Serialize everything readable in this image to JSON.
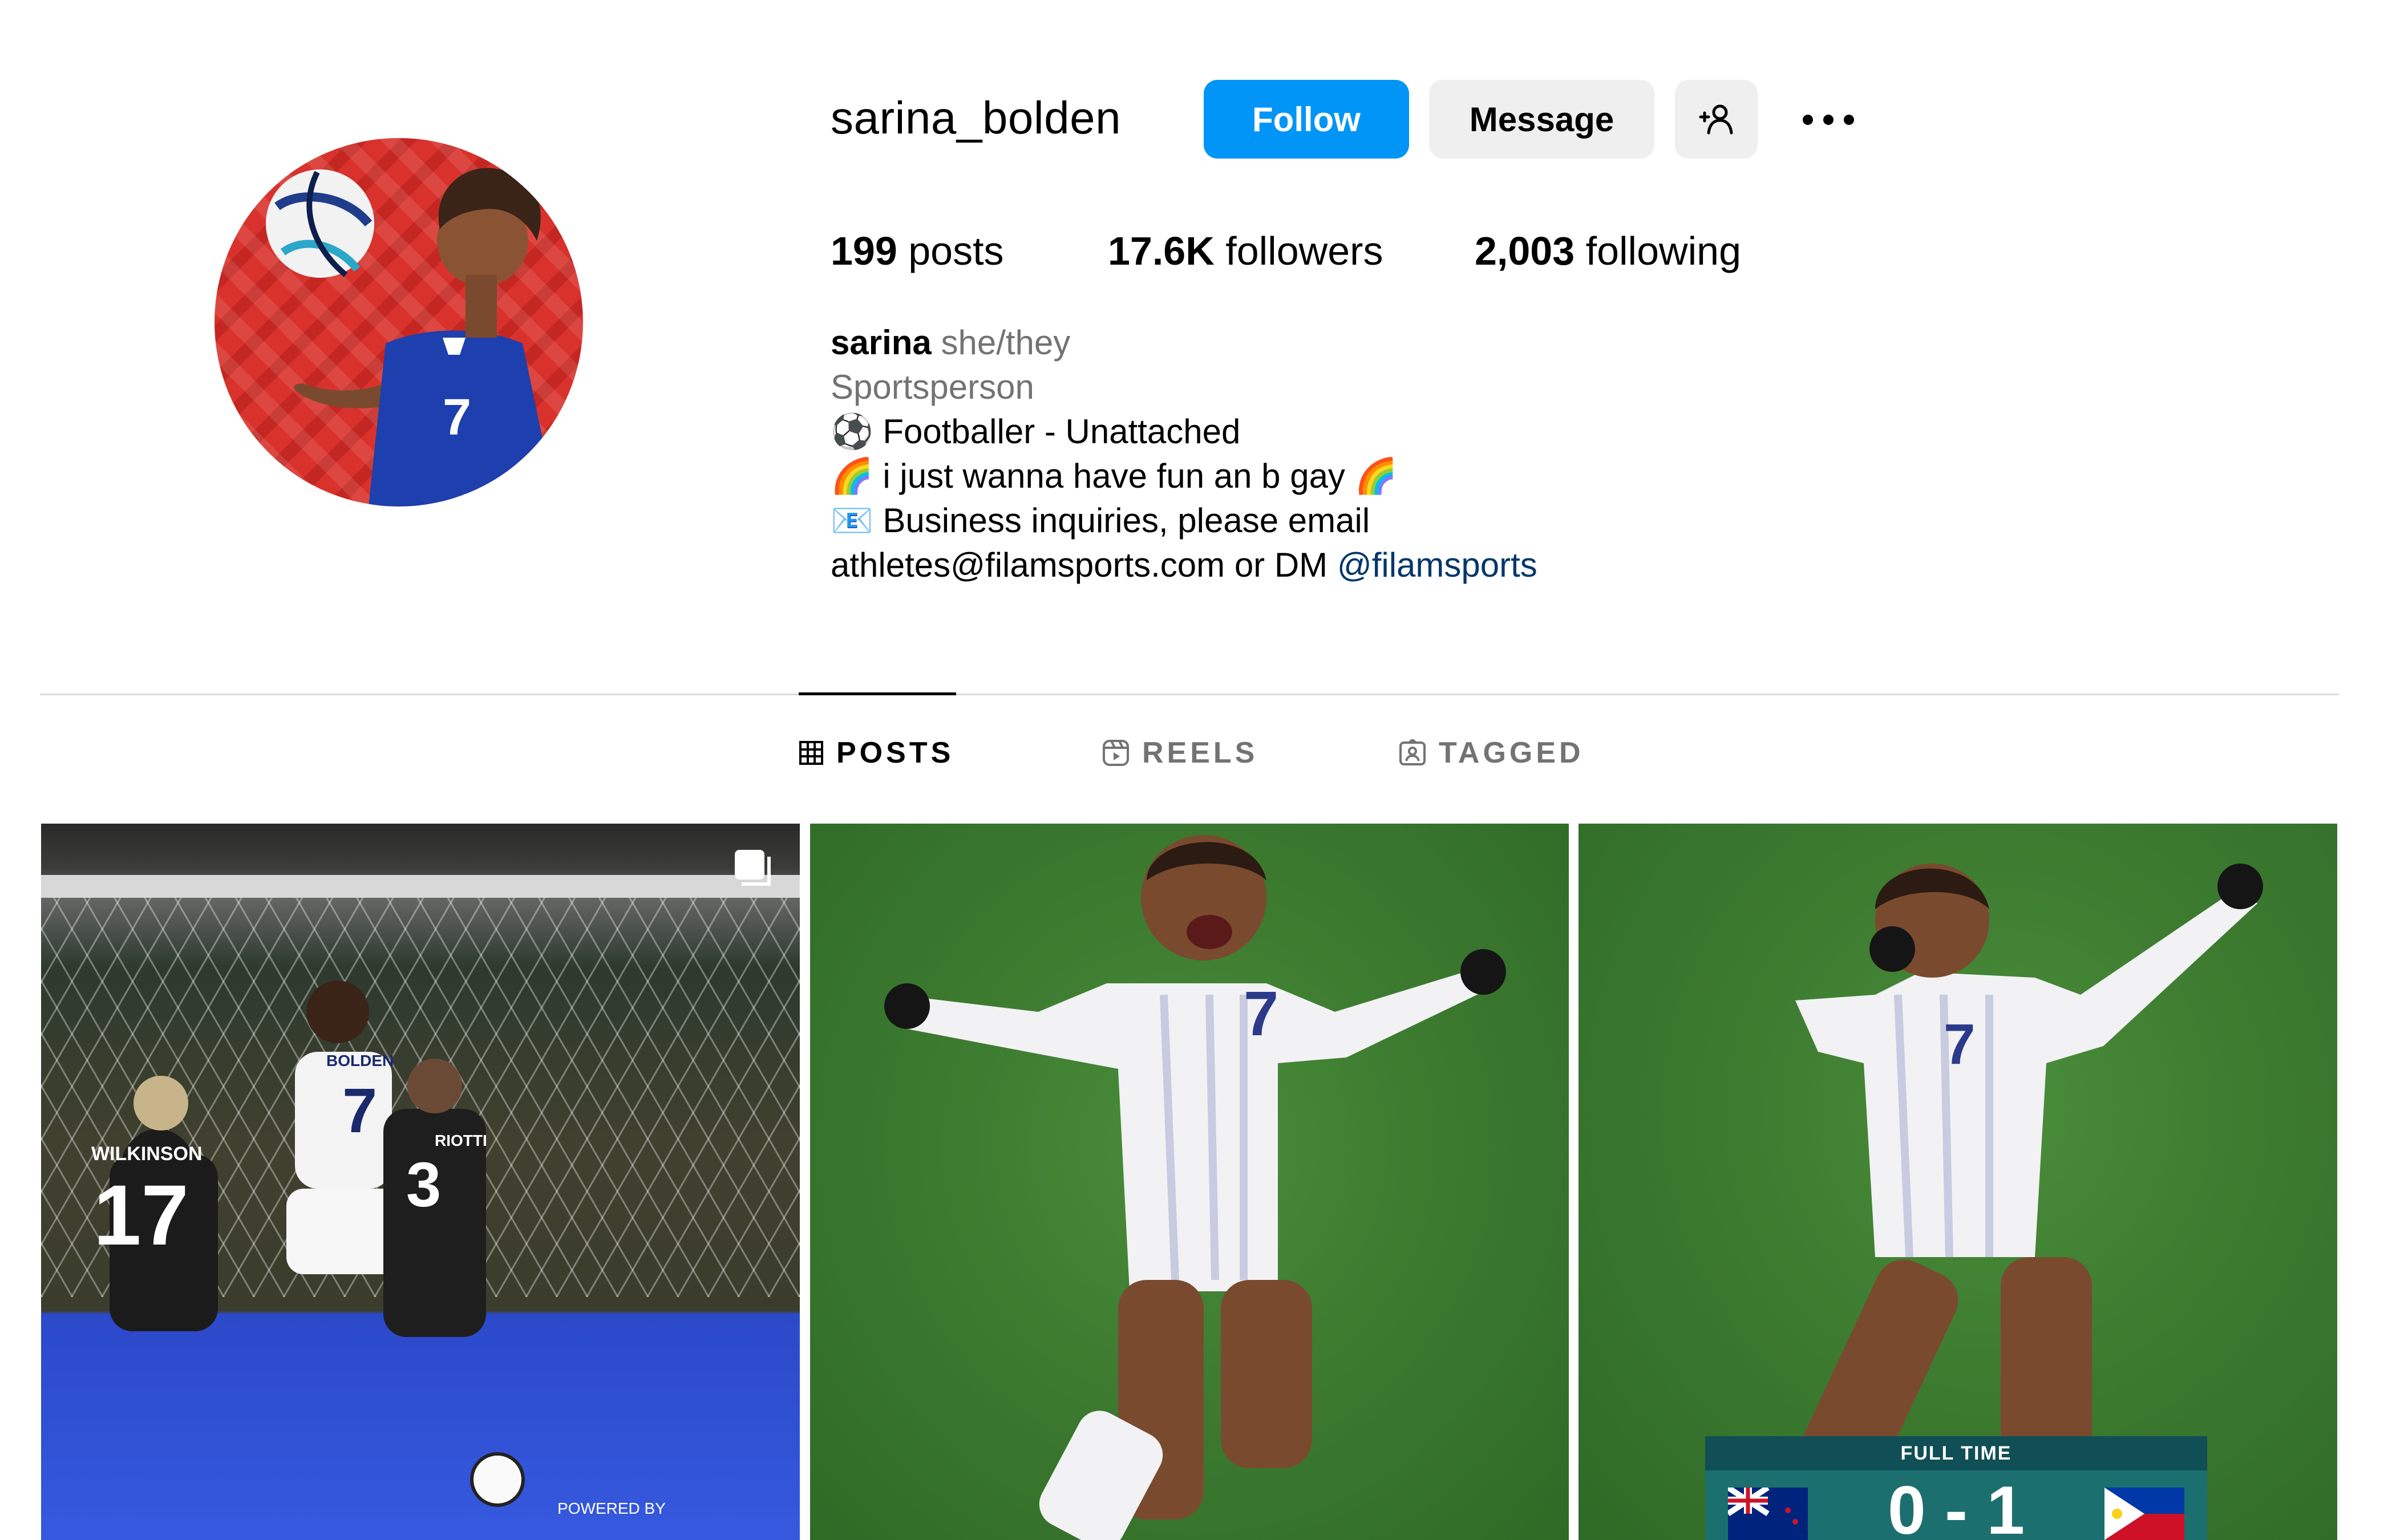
{
  "profile": {
    "username": "sarina_bolden",
    "follow_label": "Follow",
    "message_label": "Message"
  },
  "stats": {
    "posts_count": "199",
    "posts_label": "posts",
    "followers_count": "17.6K",
    "followers_label": "followers",
    "following_count": "2,003",
    "following_label": "following"
  },
  "bio": {
    "name": "sarina",
    "pronouns": "she/they",
    "category": "Sportsperson",
    "line1": "⚽ Footballer - Unattached",
    "line2": "🌈 i just wanna have fun an b gay 🌈",
    "line3": "📧 Business inquiries, please email",
    "line4_text": "athletes@filamsports.com or DM ",
    "line4_link": "@filamsports"
  },
  "tabs": [
    {
      "label": "POSTS",
      "icon": "grid-icon",
      "active": true
    },
    {
      "label": "REELS",
      "icon": "reels-icon",
      "active": false
    },
    {
      "label": "TAGGED",
      "icon": "tagged-icon",
      "active": false
    }
  ],
  "posts": {
    "post1": {
      "jersey_left": "17",
      "name_left": "WILKINSON",
      "jersey_center": "7",
      "name_center": "BOLDEN",
      "jersey_right": "3",
      "name_right": "RIOTTI",
      "overlay_text": "POWERED BY"
    },
    "post2": {
      "jersey": "7"
    },
    "post3": {
      "jersey": "7",
      "scoreboard_title": "FULL TIME",
      "score": "0 - 1"
    }
  },
  "colors": {
    "follow_button": "#0095f6",
    "link": "#00376b",
    "secondary_button": "#efefef"
  }
}
